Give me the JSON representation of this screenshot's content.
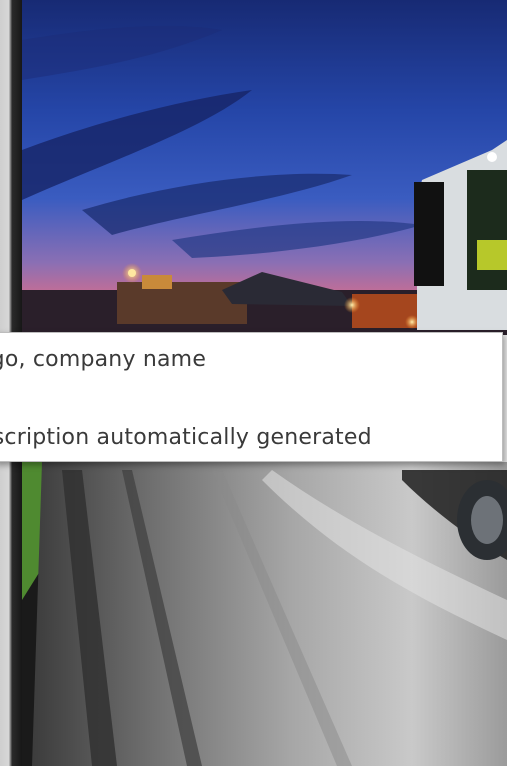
{
  "alt_text_tooltip": {
    "line1": "ogo, company name",
    "line2": "escription automatically generated"
  },
  "colors": {
    "sky_top": "#1a2f7a",
    "sky_mid": "#2d4fb0",
    "horizon_pink": "#c06a9a",
    "road": "#8a8a8a",
    "tooltip_bg": "#ffffff",
    "tooltip_text": "#3a3a3a"
  }
}
